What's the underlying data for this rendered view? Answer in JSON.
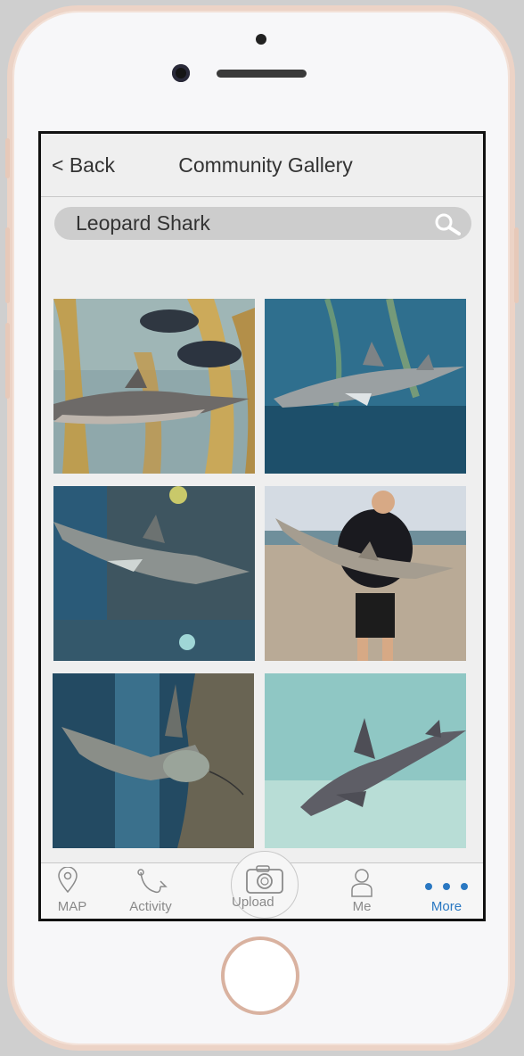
{
  "header": {
    "back_label": "< Back",
    "title": "Community Gallery"
  },
  "search": {
    "value": "Leopard Shark"
  },
  "gallery": {
    "items": [
      "aquarium-kelp-shark",
      "kelp-forest-shark",
      "aquarium-rock-shark",
      "beach-catch-shark",
      "aquarium-front-shark",
      "sandy-bottom-shark"
    ]
  },
  "tabbar": {
    "items": [
      {
        "label": "MAP",
        "icon": "map-pin-icon"
      },
      {
        "label": "Activity",
        "icon": "fishing-line-icon"
      },
      {
        "label": "Upload",
        "icon": "camera-icon"
      },
      {
        "label": "Me",
        "icon": "person-icon"
      },
      {
        "label": "More",
        "icon": "more-dots-icon"
      }
    ],
    "active": "More"
  },
  "colors": {
    "accent": "#2a78c2",
    "inactive": "#8a8a8a",
    "frame": "#ecd3c6"
  }
}
